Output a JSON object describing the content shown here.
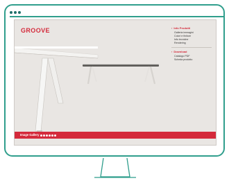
{
  "window": {
    "dots": [
      "dot-1",
      "dot-2",
      "dot-3"
    ]
  },
  "page": {
    "brand": "GROOVE",
    "menu": {
      "section1": {
        "title": "Info Prodotti",
        "items": [
          "Galleria immagini",
          "Colori e finiture",
          "Info tecniche",
          "Rendering"
        ]
      },
      "section2": {
        "title": "Download",
        "items": [
          "Catalogo PDF",
          "Scheda prodotto"
        ]
      }
    },
    "gallery": {
      "label": "Image Gallery",
      "pages": 6
    }
  },
  "colors": {
    "accent": "#d42a3b",
    "frame": "#2f9e8c",
    "screen_bg": "#e9e6e3"
  }
}
